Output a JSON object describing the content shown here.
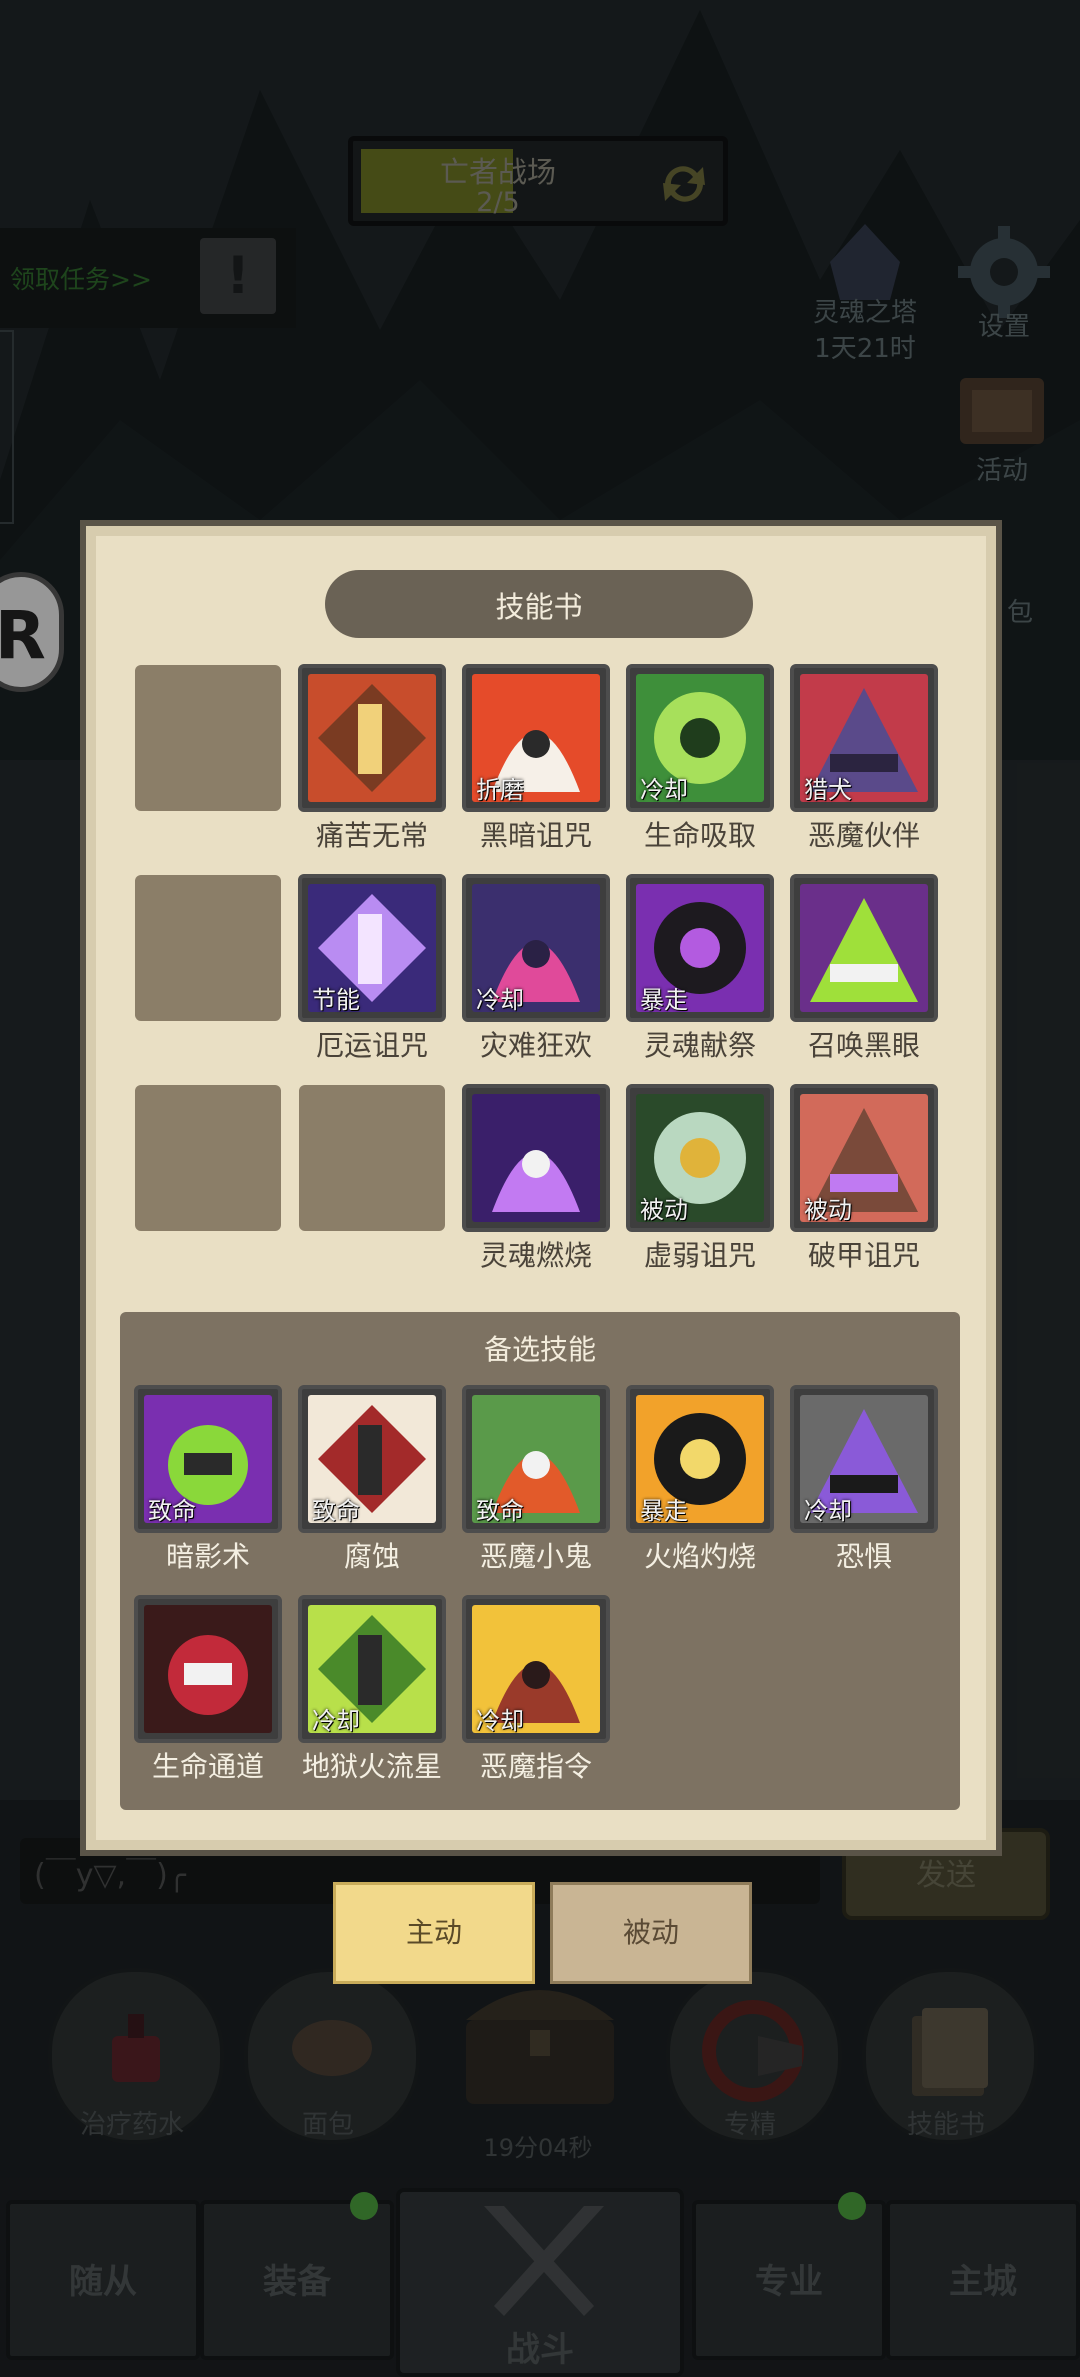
{
  "hud": {
    "stage_name": "亡者战场",
    "stage_progress": "2/5",
    "stage_progress_value": 0.4,
    "task_label": "领取任务>>",
    "soul_tower_label": "灵魂之塔",
    "soul_tower_timer": "1天21时",
    "settings_label": "设置",
    "activity_label": "活动",
    "bag_label_partial": "包"
  },
  "panel": {
    "title": "技能书",
    "rows": [
      [
        {
          "name": "",
          "tag": "",
          "empty": true
        },
        {
          "name": "痛苦无常",
          "tag": "",
          "palette": [
            "#c84d2c",
            "#7a3b22",
            "#f1d17a"
          ]
        },
        {
          "name": "黑暗诅咒",
          "tag": "折磨",
          "palette": [
            "#e54b2a",
            "#f6f0e8",
            "#2a2a2a"
          ]
        },
        {
          "name": "生命吸取",
          "tag": "冷却",
          "palette": [
            "#3e8f3a",
            "#a7e05b",
            "#1f3d1c"
          ]
        },
        {
          "name": "恶魔伙伴",
          "tag": "猎犬",
          "palette": [
            "#c23b4a",
            "#5a4a8a",
            "#2b2440"
          ]
        }
      ],
      [
        {
          "name": "",
          "tag": "",
          "empty": true
        },
        {
          "name": "厄运诅咒",
          "tag": "节能",
          "palette": [
            "#3a2a7a",
            "#b98cf2",
            "#f3e4ff"
          ]
        },
        {
          "name": "灾难狂欢",
          "tag": "冷却",
          "palette": [
            "#3b2f6e",
            "#e04a9a",
            "#2a2145"
          ]
        },
        {
          "name": "灵魂献祭",
          "tag": "暴走",
          "palette": [
            "#7a2fb0",
            "#1d1a1f",
            "#b35be0"
          ]
        },
        {
          "name": "召唤黑眼",
          "tag": "",
          "palette": [
            "#6a2f8a",
            "#9fe03a",
            "#f2f2f2"
          ]
        }
      ],
      [
        {
          "name": "",
          "tag": "",
          "empty": true
        },
        {
          "name": "",
          "tag": "",
          "empty": true
        },
        {
          "name": "灵魂燃烧",
          "tag": "",
          "palette": [
            "#3a1f6a",
            "#c27af2",
            "#f2f2f2"
          ]
        },
        {
          "name": "虚弱诅咒",
          "tag": "被动",
          "palette": [
            "#2a4a2a",
            "#b9d8c0",
            "#e0b33a"
          ]
        },
        {
          "name": "破甲诅咒",
          "tag": "被动",
          "palette": [
            "#d26a5a",
            "#7a4a3a",
            "#c07af2"
          ]
        }
      ]
    ]
  },
  "alternates": {
    "title": "备选技能",
    "rows": [
      [
        {
          "name": "暗影术",
          "tag": "致命",
          "palette": [
            "#7a2fb0",
            "#8ad83a",
            "#2a2a2a"
          ]
        },
        {
          "name": "腐蚀",
          "tag": "致命",
          "palette": [
            "#f2e8d8",
            "#a32a2a",
            "#2a2a2a"
          ]
        },
        {
          "name": "恶魔小鬼",
          "tag": "致命",
          "palette": [
            "#5a9a4a",
            "#e25a2a",
            "#f2f2f2"
          ]
        },
        {
          "name": "火焰灼烧",
          "tag": "暴走",
          "palette": [
            "#f2a22a",
            "#1a1a1a",
            "#f2d86a"
          ]
        },
        {
          "name": "恐惧",
          "tag": "冷却",
          "palette": [
            "#6a6a6a",
            "#8a5ad8",
            "#1a1a1a"
          ]
        }
      ],
      [
        {
          "name": "生命通道",
          "tag": "",
          "palette": [
            "#3a1a1a",
            "#c22a3a",
            "#f2f2f2"
          ]
        },
        {
          "name": "地狱火流星",
          "tag": "冷却",
          "palette": [
            "#b8e04a",
            "#4a8a2a",
            "#2a2a2a"
          ]
        },
        {
          "name": "恶魔指令",
          "tag": "冷却",
          "palette": [
            "#f2c23a",
            "#9a3a2a",
            "#2a1a1a"
          ]
        }
      ]
    ]
  },
  "chat": {
    "text": "(￣y▽,￣)╭",
    "send_label": "发送"
  },
  "tabs": {
    "active_label": "主动",
    "passive_label": "被动"
  },
  "quick_slots": [
    {
      "label": "治疗药水"
    },
    {
      "label": "面包"
    },
    {
      "label": "19分04秒"
    },
    {
      "label": "专精"
    },
    {
      "label": "技能书"
    }
  ],
  "nav": [
    {
      "label": "随从"
    },
    {
      "label": "装备"
    },
    {
      "label": "战斗"
    },
    {
      "label": "专业"
    },
    {
      "label": "主城"
    }
  ]
}
